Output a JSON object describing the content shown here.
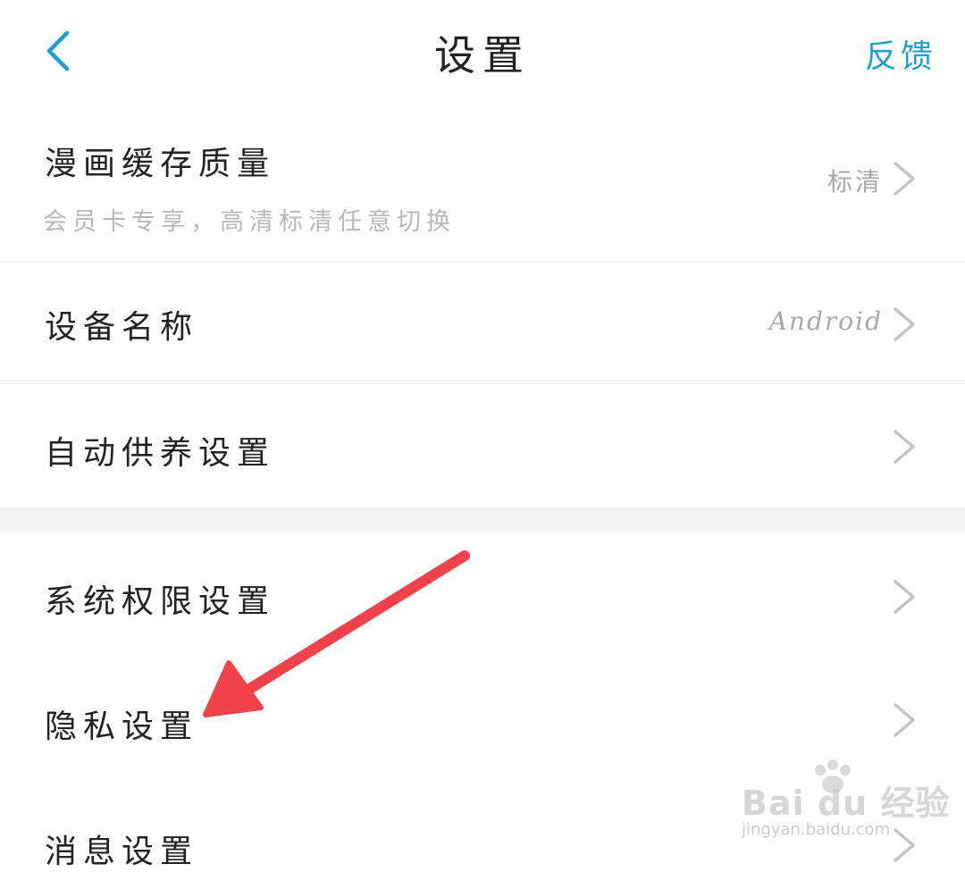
{
  "header": {
    "title": "设置",
    "feedback_label": "反馈"
  },
  "settings": {
    "comic_cache_quality": {
      "title": "漫画缓存质量",
      "subtitle": "会员卡专享，高清标清任意切换",
      "value": "标清"
    },
    "device_name": {
      "title": "设备名称",
      "value": "Android"
    },
    "auto_feed": {
      "title": "自动供养设置"
    },
    "system_permissions": {
      "title": "系统权限设置"
    },
    "privacy": {
      "title": "隐私设置"
    },
    "message": {
      "title": "消息设置"
    }
  },
  "watermark": {
    "brand": "Bai du 经验",
    "url": "jingyan.baidu.com"
  },
  "colors": {
    "accent": "#1e9fd4",
    "annotation_arrow": "#f0424a",
    "chevron": "#c4c4c4"
  },
  "icons": {
    "back": "back-icon",
    "chevron": "chevron-right-icon",
    "annotation": "red-arrow-annotation"
  }
}
